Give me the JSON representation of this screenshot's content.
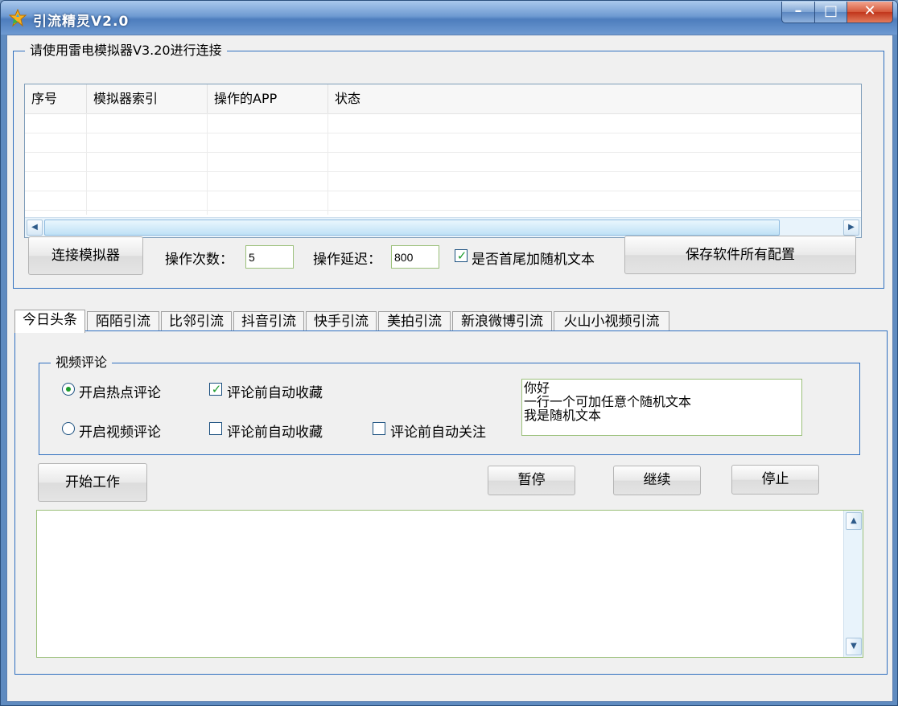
{
  "window": {
    "title": "引流精灵V2.0",
    "min_glyph": "–",
    "max_glyph": "□",
    "close_glyph": "✕"
  },
  "connection": {
    "group_title": "请使用雷电模拟器V3.20进行连接",
    "columns": [
      "序号",
      "模拟器索引",
      "操作的APP",
      "状态"
    ],
    "connect_button": "连接模拟器",
    "op_count_label": "操作次数：",
    "op_count_value": "5",
    "op_delay_label": "操作延迟：",
    "op_delay_value": "800",
    "random_text_label": "是否首尾加随机文本",
    "random_text_checked": true,
    "save_button": "保存软件所有配置"
  },
  "tabs": [
    "今日头条",
    "陌陌引流",
    "比邻引流",
    "抖音引流",
    "快手引流",
    "美拍引流",
    "新浪微博引流",
    "火山小视频引流"
  ],
  "active_tab": 0,
  "video_comment": {
    "group_title": "视频评论",
    "hot_comment_label": "开启热点评论",
    "video_comment_label": "开启视频评论",
    "auto_collect_label_1": "评论前自动收藏",
    "auto_collect_label_2": "评论前自动收藏",
    "auto_follow_label": "评论前自动关注",
    "random_texts": "你好\n一行一个可加任意个随机文本\n我是随机文本"
  },
  "controls": {
    "start": "开始工作",
    "pause": "暂停",
    "resume": "继续",
    "stop": "停止"
  },
  "log": {
    "text": ""
  },
  "icons": {
    "scroll_left": "◀",
    "scroll_right": "▶",
    "scroll_up": "▲",
    "scroll_down": "▼",
    "check": "✓"
  }
}
